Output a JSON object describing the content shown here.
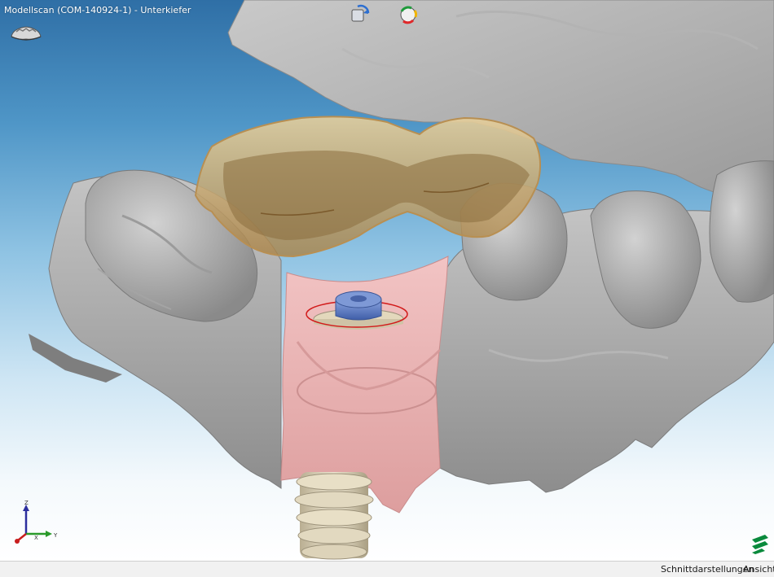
{
  "window": {
    "title": "Modellscan (COM-140924-1) - Unterkiefer"
  },
  "toolbar": {
    "buttons": [
      {
        "name": "view-rotate-button",
        "icon": "rotate-view-icon"
      },
      {
        "name": "show-hide-button",
        "icon": "visibility-toggle-icon"
      }
    ]
  },
  "axes": {
    "z_label": "Z",
    "x_label": "X",
    "y_label": "Y"
  },
  "statusbar": {
    "section_views_label": "Schnittdarstellungen",
    "view_label": "Ansicht"
  },
  "colors": {
    "background_top": "#2f6fa6",
    "background_bottom": "#ffffff",
    "scan_gray": "#a8a8a8",
    "gingiva_pink": "#e8b0b0",
    "bridge_tan": "#c7a36a",
    "abutment_blue": "#5e7fc4",
    "implant_beige": "#d9cfb4",
    "brand_green": "#0a8a3c"
  }
}
